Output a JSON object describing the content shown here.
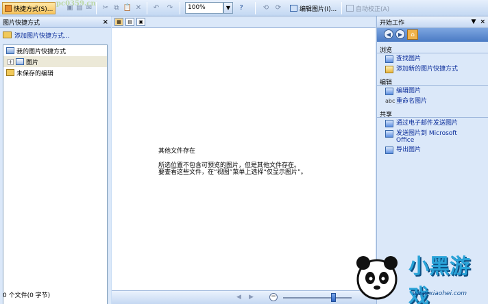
{
  "toolbar": {
    "shortcuts_button": "快捷方式(S)...",
    "watermark": "pc0359.cn",
    "zoom_value": "100%",
    "edit_picture_button": "编辑图片(I)...",
    "auto_correct_button": "自动校正(A)"
  },
  "left_pane": {
    "title": "图片快捷方式",
    "add_link": "添加图片快捷方式...",
    "tree": [
      {
        "label": "我的图片快捷方式",
        "expander": "",
        "selected": false
      },
      {
        "label": "图片",
        "expander": "+",
        "selected": true
      },
      {
        "label": "未保存的编辑",
        "expander": "",
        "selected": false
      }
    ],
    "status": "0 个文件(0 字节)"
  },
  "middle_pane": {
    "message_title": "其他文件存在",
    "message_line1": "所选位置不包含可预览的图片，但是其他文件存在。",
    "message_line2": "要查看这些文件，在“视图”菜单上选择“仅显示图片”。"
  },
  "right_pane": {
    "title": "开始工作",
    "sections": [
      {
        "title": "浏览",
        "links": [
          "查找图片",
          "添加新的图片快捷方式"
        ]
      },
      {
        "title": "编辑",
        "links": [
          "编辑图片",
          "重命名图片"
        ]
      },
      {
        "title": "共享",
        "links": [
          "通过电子邮件发送图片",
          "发送图片到 Microsoft Office",
          "导出图片"
        ]
      }
    ]
  },
  "logo": {
    "text": "小黑游戏",
    "url": "www.xiaohei.com"
  },
  "colors": {
    "link": "#0a2c9a",
    "toolbar_bg": "#c2d7f2",
    "highlight": "#f6c35d"
  }
}
